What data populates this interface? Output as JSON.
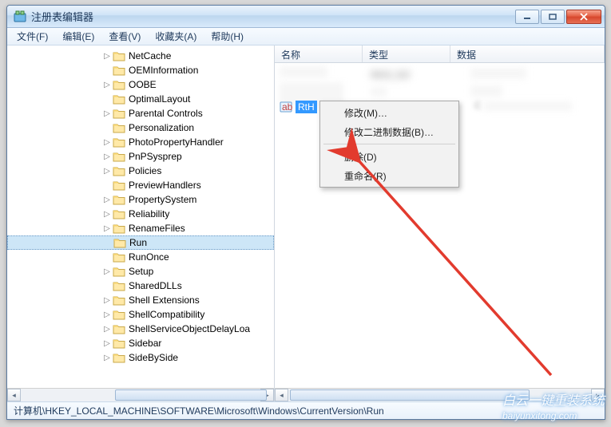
{
  "window": {
    "title": "注册表编辑器"
  },
  "menubar": [
    "文件(F)",
    "编辑(E)",
    "查看(V)",
    "收藏夹(A)",
    "帮助(H)"
  ],
  "tree": {
    "items": [
      {
        "label": "NetCache",
        "exp": "▷"
      },
      {
        "label": "OEMInformation",
        "exp": ""
      },
      {
        "label": "OOBE",
        "exp": "▷"
      },
      {
        "label": "OptimalLayout",
        "exp": ""
      },
      {
        "label": "Parental Controls",
        "exp": "▷"
      },
      {
        "label": "Personalization",
        "exp": ""
      },
      {
        "label": "PhotoPropertyHandler",
        "exp": "▷"
      },
      {
        "label": "PnPSysprep",
        "exp": "▷"
      },
      {
        "label": "Policies",
        "exp": "▷"
      },
      {
        "label": "PreviewHandlers",
        "exp": ""
      },
      {
        "label": "PropertySystem",
        "exp": "▷"
      },
      {
        "label": "Reliability",
        "exp": "▷"
      },
      {
        "label": "RenameFiles",
        "exp": "▷"
      },
      {
        "label": "Run",
        "exp": "",
        "selected": true
      },
      {
        "label": "RunOnce",
        "exp": ""
      },
      {
        "label": "Setup",
        "exp": "▷"
      },
      {
        "label": "SharedDLLs",
        "exp": ""
      },
      {
        "label": "Shell Extensions",
        "exp": "▷"
      },
      {
        "label": "ShellCompatibility",
        "exp": "▷"
      },
      {
        "label": "ShellServiceObjectDelayLoa",
        "exp": "▷"
      },
      {
        "label": "Sidebar",
        "exp": "▷"
      },
      {
        "label": "SideBySide",
        "exp": "▷"
      }
    ]
  },
  "columns": {
    "name": "名称",
    "type": "类型",
    "data": "数据"
  },
  "values": {
    "typelabel": "REG_SZ",
    "selname": "RtH",
    "selextra": "C"
  },
  "contextmenu": {
    "modify": "修改(M)…",
    "modify_bin": "修改二进制数据(B)…",
    "delete": "删除(D)",
    "rename": "重命名(R)"
  },
  "statusbar": {
    "path": "计算机\\HKEY_LOCAL_MACHINE\\SOFTWARE\\Microsoft\\Windows\\CurrentVersion\\Run"
  },
  "watermark": {
    "cn": "白云一键重装系统",
    "url": "baiyunxitong.com"
  },
  "colors": {
    "titlebar": "#cfe3f7",
    "selection": "#3399ff",
    "closebtn": "#d6452b"
  }
}
